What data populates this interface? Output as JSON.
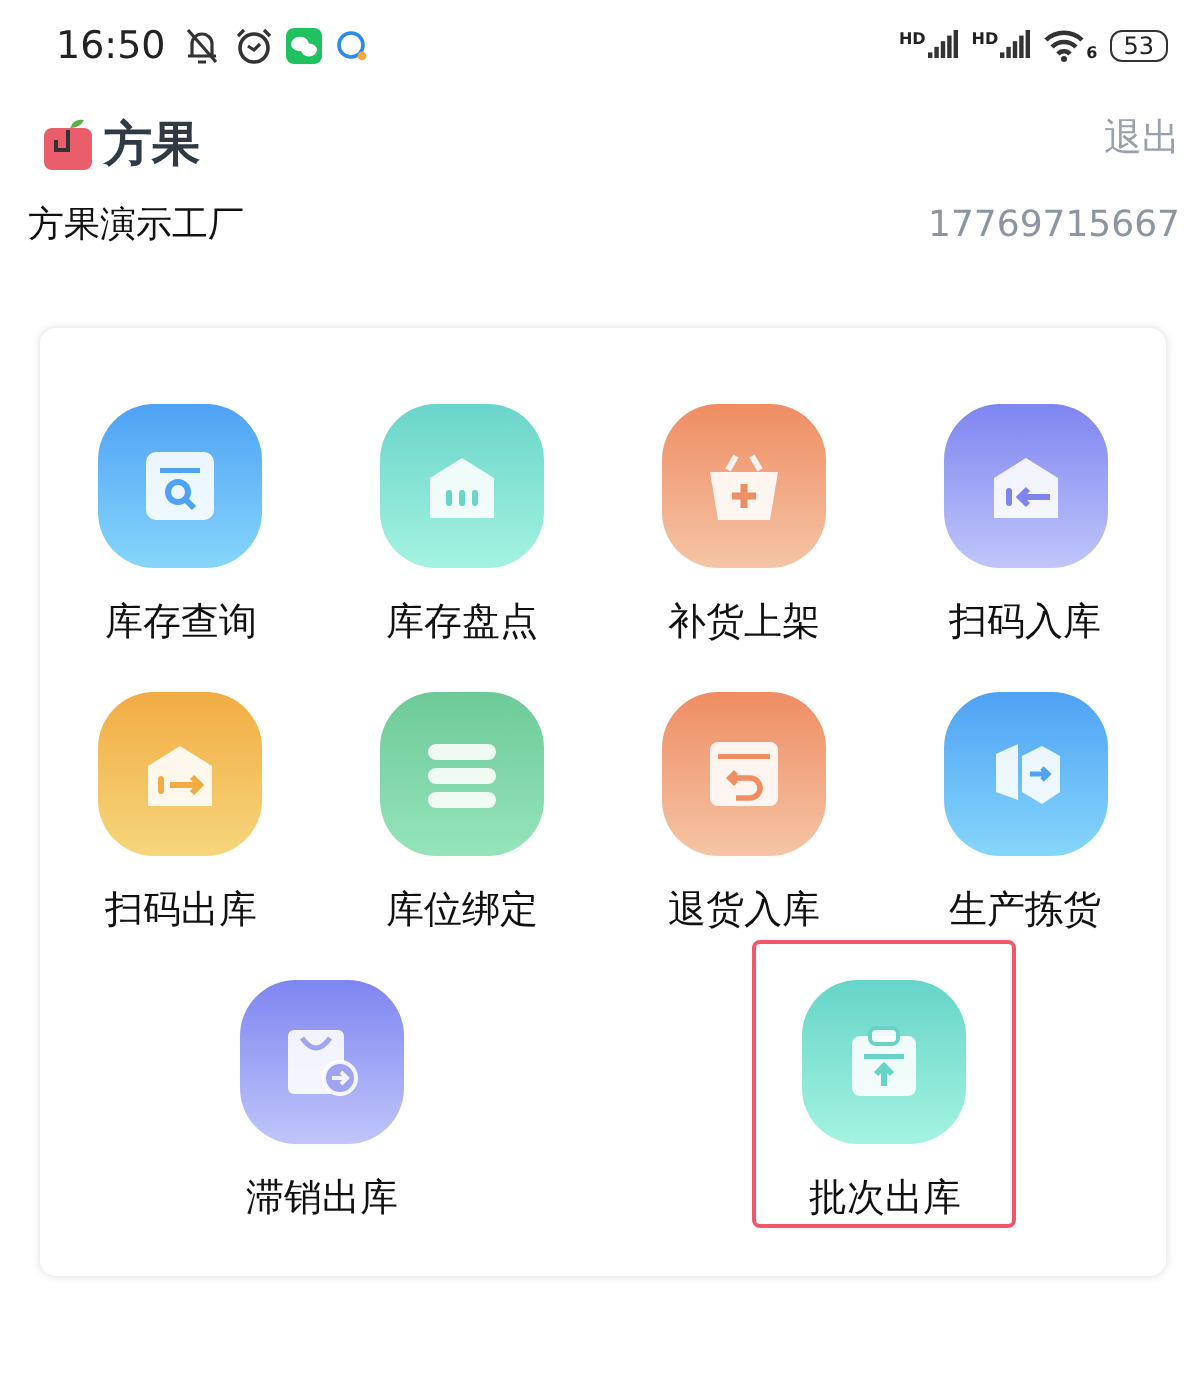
{
  "status_bar": {
    "time": "16:50",
    "signal_labels": [
      "HD",
      "HD"
    ],
    "wifi_label": "6",
    "battery": "53"
  },
  "header": {
    "app_name": "方果",
    "logout": "退出",
    "company": "方果演示工厂",
    "phone": "17769715667"
  },
  "menu_rows": [
    [
      {
        "label": "库存查询",
        "selected": false
      },
      {
        "label": "库存盘点",
        "selected": false
      },
      {
        "label": "补货上架",
        "selected": false
      },
      {
        "label": "扫码入库",
        "selected": false
      }
    ],
    [
      {
        "label": "扫码出库",
        "selected": false
      },
      {
        "label": "库位绑定",
        "selected": false
      },
      {
        "label": "退货入库",
        "selected": false
      },
      {
        "label": "生产拣货",
        "selected": false
      }
    ],
    [
      {
        "label": "滞销出库",
        "selected": false
      },
      {
        "label": "批次出库",
        "selected": true
      }
    ]
  ]
}
